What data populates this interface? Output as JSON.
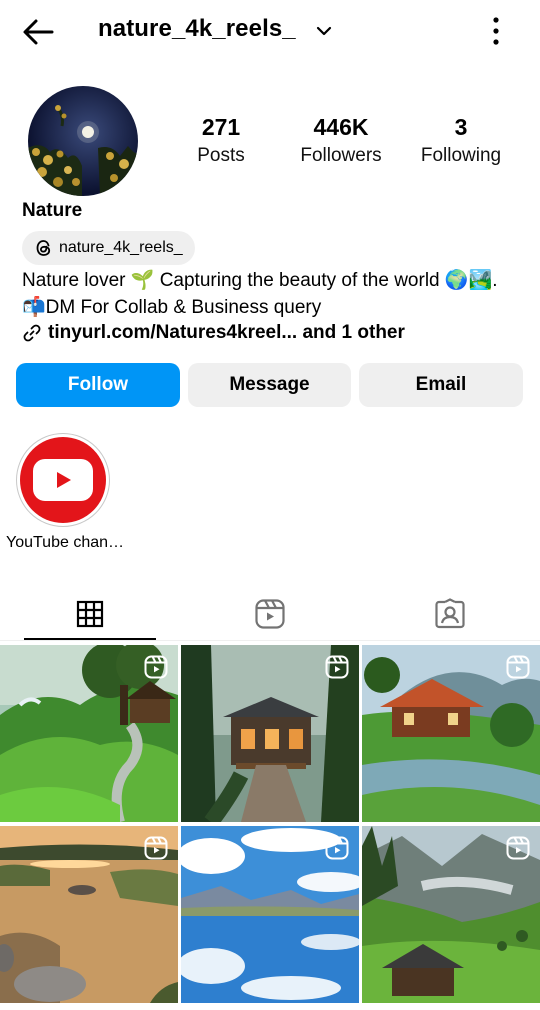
{
  "header": {
    "username": "nature_4k_reels_",
    "back_icon": "arrow-left-icon",
    "dropdown_icon": "chevron-down-icon",
    "more_icon": "more-vertical-icon"
  },
  "profile": {
    "display_name": "Nature",
    "threads_handle": "nature_4k_reels_",
    "bio_line1": "Nature lover 🌱 Capturing the beauty of the world 🌍🏞️.",
    "bio_line2": "📬DM For Collab & Business query",
    "link_text": "tinyurl.com/Natures4kreel... and 1 other"
  },
  "stats": [
    {
      "value": "271",
      "label": "Posts"
    },
    {
      "value": "446K",
      "label": "Followers"
    },
    {
      "value": "3",
      "label": "Following"
    }
  ],
  "actions": {
    "follow": "Follow",
    "message": "Message",
    "email": "Email"
  },
  "highlights": [
    {
      "label": "YouTube chan…",
      "icon": "youtube-icon"
    }
  ],
  "tabs": [
    {
      "icon": "grid-icon",
      "active": true
    },
    {
      "icon": "reels-icon",
      "active": false
    },
    {
      "icon": "tagged-icon",
      "active": false
    }
  ],
  "colors": {
    "accent": "#0095f6",
    "button_secondary": "#efefef",
    "youtube_red": "#e3151a"
  }
}
